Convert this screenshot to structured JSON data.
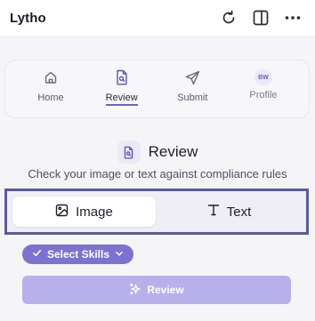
{
  "app": {
    "title": "Lytho"
  },
  "topbar": {
    "icons": [
      "refresh-icon",
      "split-panel-icon",
      "more-icon"
    ]
  },
  "nav": {
    "items": [
      {
        "label": "Home",
        "icon": "home-icon"
      },
      {
        "label": "Review",
        "icon": "document-review-icon",
        "active": true
      },
      {
        "label": "Submit",
        "icon": "send-icon"
      },
      {
        "label": "Profile",
        "avatar_initials": "BW"
      }
    ]
  },
  "section": {
    "title": "Review",
    "subtitle": "Check your image or text against compliance rules"
  },
  "mode_toggle": {
    "options": [
      {
        "label": "Image",
        "icon": "image-icon",
        "selected": true
      },
      {
        "label": "Text",
        "icon": "text-icon",
        "selected": false
      }
    ]
  },
  "skills": {
    "label": "Select Skills"
  },
  "review_button": {
    "label": "Review",
    "disabled": true
  },
  "colors": {
    "accent": "#6b63c8",
    "pill": "#7b72d1",
    "button_disabled": "#b7b0ea",
    "highlight_border": "#5b5a9e"
  }
}
